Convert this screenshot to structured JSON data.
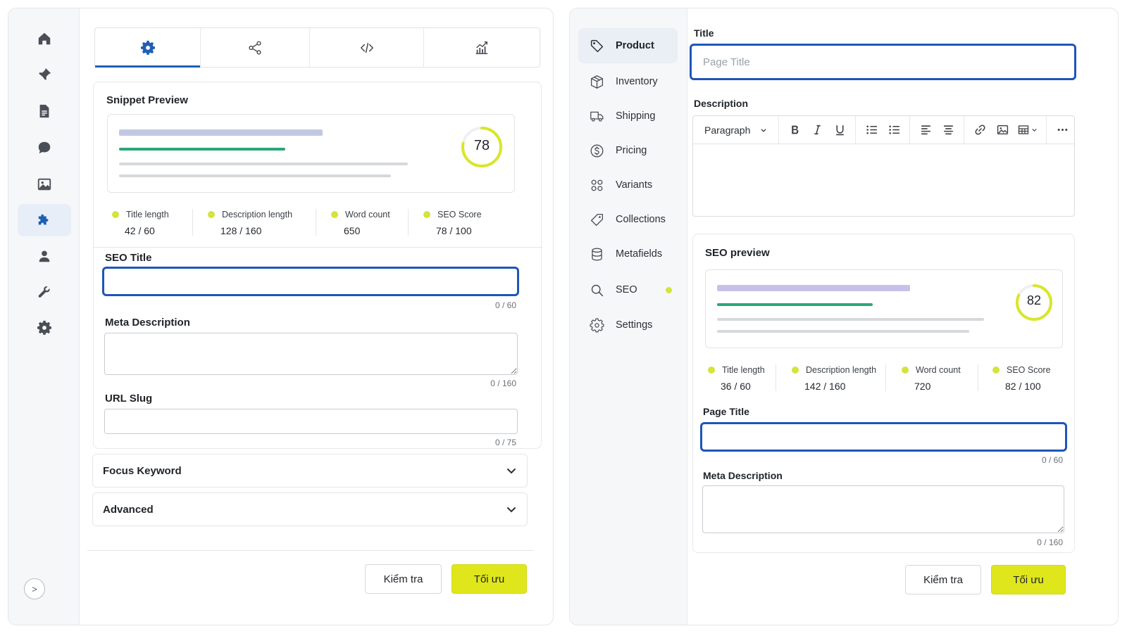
{
  "left": {
    "rail": {
      "items": [
        {
          "icon": "home-icon"
        },
        {
          "icon": "pin-icon"
        },
        {
          "icon": "document-icon"
        },
        {
          "icon": "chat-icon"
        },
        {
          "icon": "image-icon"
        },
        {
          "icon": "puzzle-icon",
          "active": true
        },
        {
          "icon": "user-icon"
        },
        {
          "icon": "wrench-icon"
        },
        {
          "icon": "gear-icon"
        }
      ],
      "toggle": ">"
    },
    "tabs": [
      {
        "icon": "gear-icon",
        "active": true
      },
      {
        "icon": "share-icon"
      },
      {
        "icon": "code-icon"
      },
      {
        "icon": "analytics-icon"
      }
    ],
    "snippet": {
      "title": "Snippet Preview",
      "score": "78",
      "score_value": 78,
      "title_bar_color": "#c3c8e2",
      "desc_bar_color": "#2aa876",
      "metrics": [
        {
          "label": "Title length",
          "value": "42 / 60"
        },
        {
          "label": "Description length",
          "value": "128 / 160"
        },
        {
          "label": "Word count",
          "value": "650"
        },
        {
          "label": "SEO Score",
          "value": "78 / 100"
        }
      ]
    },
    "seo_title": {
      "label": "SEO Title",
      "value": "",
      "counter": "0 / 60"
    },
    "meta_description": {
      "label": "Meta Description",
      "value": "",
      "counter": "0 / 160"
    },
    "url_slug": {
      "label": "URL Slug",
      "value": "",
      "counter": "0 / 75"
    },
    "focus_keyword": {
      "label": "Focus Keyword"
    },
    "advanced": {
      "label": "Advanced"
    },
    "buttons": {
      "check": "Kiểm tra",
      "optimize": "Tối ưu"
    }
  },
  "right": {
    "nav": [
      {
        "label": "Product",
        "icon": "tag-icon",
        "active": true
      },
      {
        "label": "Inventory",
        "icon": "box-icon"
      },
      {
        "label": "Shipping",
        "icon": "truck-icon"
      },
      {
        "label": "Pricing",
        "icon": "dollar-icon"
      },
      {
        "label": "Variants",
        "icon": "grid-icon"
      },
      {
        "label": "Collections",
        "icon": "label-icon"
      },
      {
        "label": "Metafields",
        "icon": "database-icon"
      },
      {
        "label": "SEO",
        "icon": "search-icon",
        "badge": true
      },
      {
        "label": "Settings",
        "icon": "gear-icon"
      }
    ],
    "title_field": {
      "label": "Title",
      "placeholder": "Page Title",
      "value": ""
    },
    "description": {
      "label": "Description",
      "format": "Paragraph"
    },
    "seo_preview": {
      "title": "SEO preview",
      "score": "82",
      "score_value": 82,
      "title_bar_color": "#c8c0ea",
      "desc_bar_color": "#2aa876",
      "metrics": [
        {
          "label": "Title length",
          "value": "36 / 60"
        },
        {
          "label": "Description length",
          "value": "142 / 160"
        },
        {
          "label": "Word count",
          "value": "720"
        },
        {
          "label": "SEO Score",
          "value": "82 / 100"
        }
      ]
    },
    "page_title": {
      "label": "Page Title",
      "value": "",
      "counter": "0 / 60"
    },
    "meta_description": {
      "label": "Meta Description",
      "value": "",
      "counter": "0 / 160"
    },
    "buttons": {
      "check": "Kiểm tra",
      "optimize": "Tối ưu"
    }
  },
  "colors": {
    "accent": "#dfe61c",
    "focus": "#1d56b8",
    "gauge": "#d9e62a",
    "active_tab": "#1f5fb4"
  }
}
